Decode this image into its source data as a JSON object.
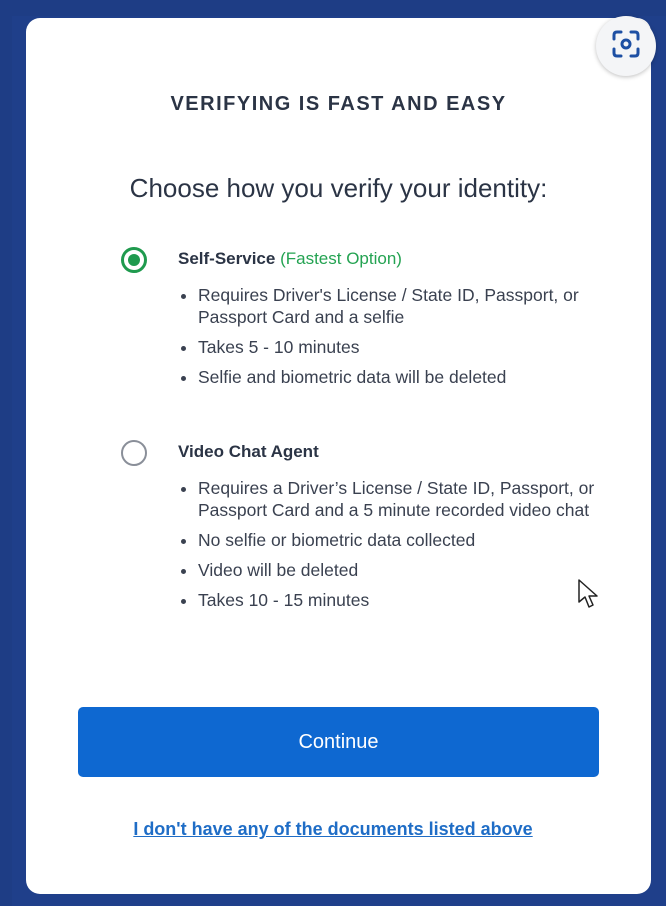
{
  "header": {
    "eyebrow": "VERIFYING IS FAST AND EASY",
    "title": "Choose how you verify your identity:"
  },
  "options": [
    {
      "name": "Self-Service",
      "tag": "(Fastest Option)",
      "selected": true,
      "bullets": [
        "Requires Driver's License / State ID, Passport, or Passport Card and a selfie",
        "Takes 5 - 10 minutes",
        "Selfie and biometric data will be deleted"
      ]
    },
    {
      "name": "Video Chat Agent",
      "tag": "",
      "selected": false,
      "bullets": [
        "Requires a Driver’s License / State ID, Passport, or Passport Card and a 5 minute recorded video chat",
        "No selfie or biometric data collected",
        "Video will be deleted",
        "Takes 10 - 15 minutes"
      ]
    }
  ],
  "actions": {
    "continue_label": "Continue",
    "no_documents_link": "I don't have any of the documents listed above"
  },
  "icons": {
    "scan": "screen-scan-icon",
    "cursor": "mouse-cursor-icon"
  },
  "colors": {
    "background": "#1f3f8a",
    "primary_button": "#0e68d1",
    "selected_radio": "#1f9a4e",
    "tag_green": "#24a352",
    "link": "#1f6dc6"
  }
}
